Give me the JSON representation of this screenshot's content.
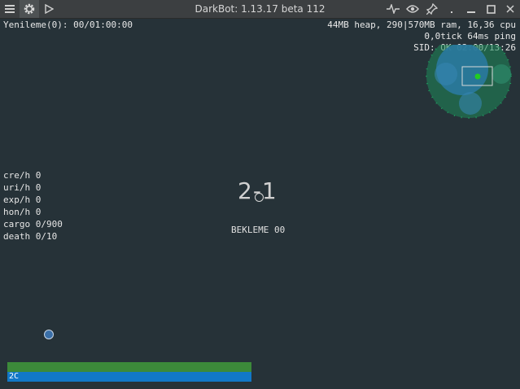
{
  "window": {
    "title": "DarkBot: 1.13.17 beta 112"
  },
  "icons": {
    "menu": "hamburger-icon",
    "settings": "gear-icon",
    "start": "play-icon",
    "stats": "pulse-icon",
    "visibility": "eye-icon",
    "pin": "pin-icon",
    "minimize": "minimize-icon",
    "maximize": "maximize-icon",
    "close": "close-icon"
  },
  "header": {
    "refresh": "Yenileme(0): 00/01:00:00",
    "memory": "44MB heap, 290|570MB ram, 16,36 cpu",
    "tick": "0,0tick 64ms ping",
    "sid": "SID: OK 02:00/13:26"
  },
  "stats": [
    {
      "label": "cre/h",
      "value": "0"
    },
    {
      "label": "uri/h",
      "value": "0"
    },
    {
      "label": "exp/h",
      "value": "0"
    },
    {
      "label": "hon/h",
      "value": "0"
    },
    {
      "label": "cargo",
      "value": "0/900"
    },
    {
      "label": "death",
      "value": "0/10"
    }
  ],
  "map": {
    "name": "2-1",
    "status": "BEKLEME 00"
  },
  "ship": {
    "bar_label": "2C",
    "hp_fraction": 1.0,
    "shield_fraction": 1.0
  },
  "colors": {
    "background": "#263238",
    "hp": "#3c8a3a",
    "shield": "#1178c8",
    "zone": "#1e8a5a",
    "base_circle": "#2a7aa0",
    "hero_dot": "#22cc22"
  }
}
